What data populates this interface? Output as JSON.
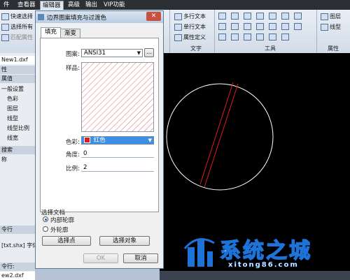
{
  "menubar": {
    "items": [
      "件",
      "查看器",
      "编辑器",
      "高级",
      "输出",
      "VIP功能"
    ],
    "active_index": 2
  },
  "ribbon": {
    "left_tools": [
      "快速选择",
      "选择所有",
      "匹配属性"
    ],
    "text_tools": [
      "多行文本",
      "单行文本",
      "属性定义"
    ],
    "layer_tools": [
      "图层",
      "线型"
    ],
    "groups": {
      "text": "文字",
      "tools": "工具",
      "props": "属性"
    }
  },
  "left_panel": {
    "file_tab": "New1.dxf",
    "rows": [
      "性",
      "属值",
      "一般设置",
      "色彩",
      "图层",
      "线型",
      "线型比例",
      "线宽"
    ],
    "section2": "搜索",
    "section2_item": "称",
    "cmd_header": "令行",
    "cmd_text": "[txt.shx] 字体",
    "cmd_footer": "令行:",
    "file_tab2": "ew2.dxf"
  },
  "dialog": {
    "title": "边界图案填充与过渡色",
    "close_label": "✕",
    "tabs": [
      "填充",
      "渐变"
    ],
    "pattern_label": "图案:",
    "pattern_value": "ANSI31",
    "browse_label": "...",
    "sample_label": "样品:",
    "color_label": "色彩:",
    "color_value": "红色",
    "color_hex": "#e11b1b",
    "angle_label": "角度:",
    "angle_value": "0",
    "scale_label": "比例:",
    "scale_value": "2",
    "select_label": "选择文档",
    "radio_inner": "内部轮廓",
    "radio_outer": "外轮廓",
    "btn_pick_points": "选择点",
    "btn_select_objects": "选择对象",
    "btn_ok": "OK",
    "btn_cancel": "取消"
  },
  "watermark": {
    "title": "系统之城",
    "url": "xitong86.com"
  },
  "colors": {
    "canvas": "#000000",
    "circle": "#ffffff",
    "hatch": "#e11b1b"
  }
}
